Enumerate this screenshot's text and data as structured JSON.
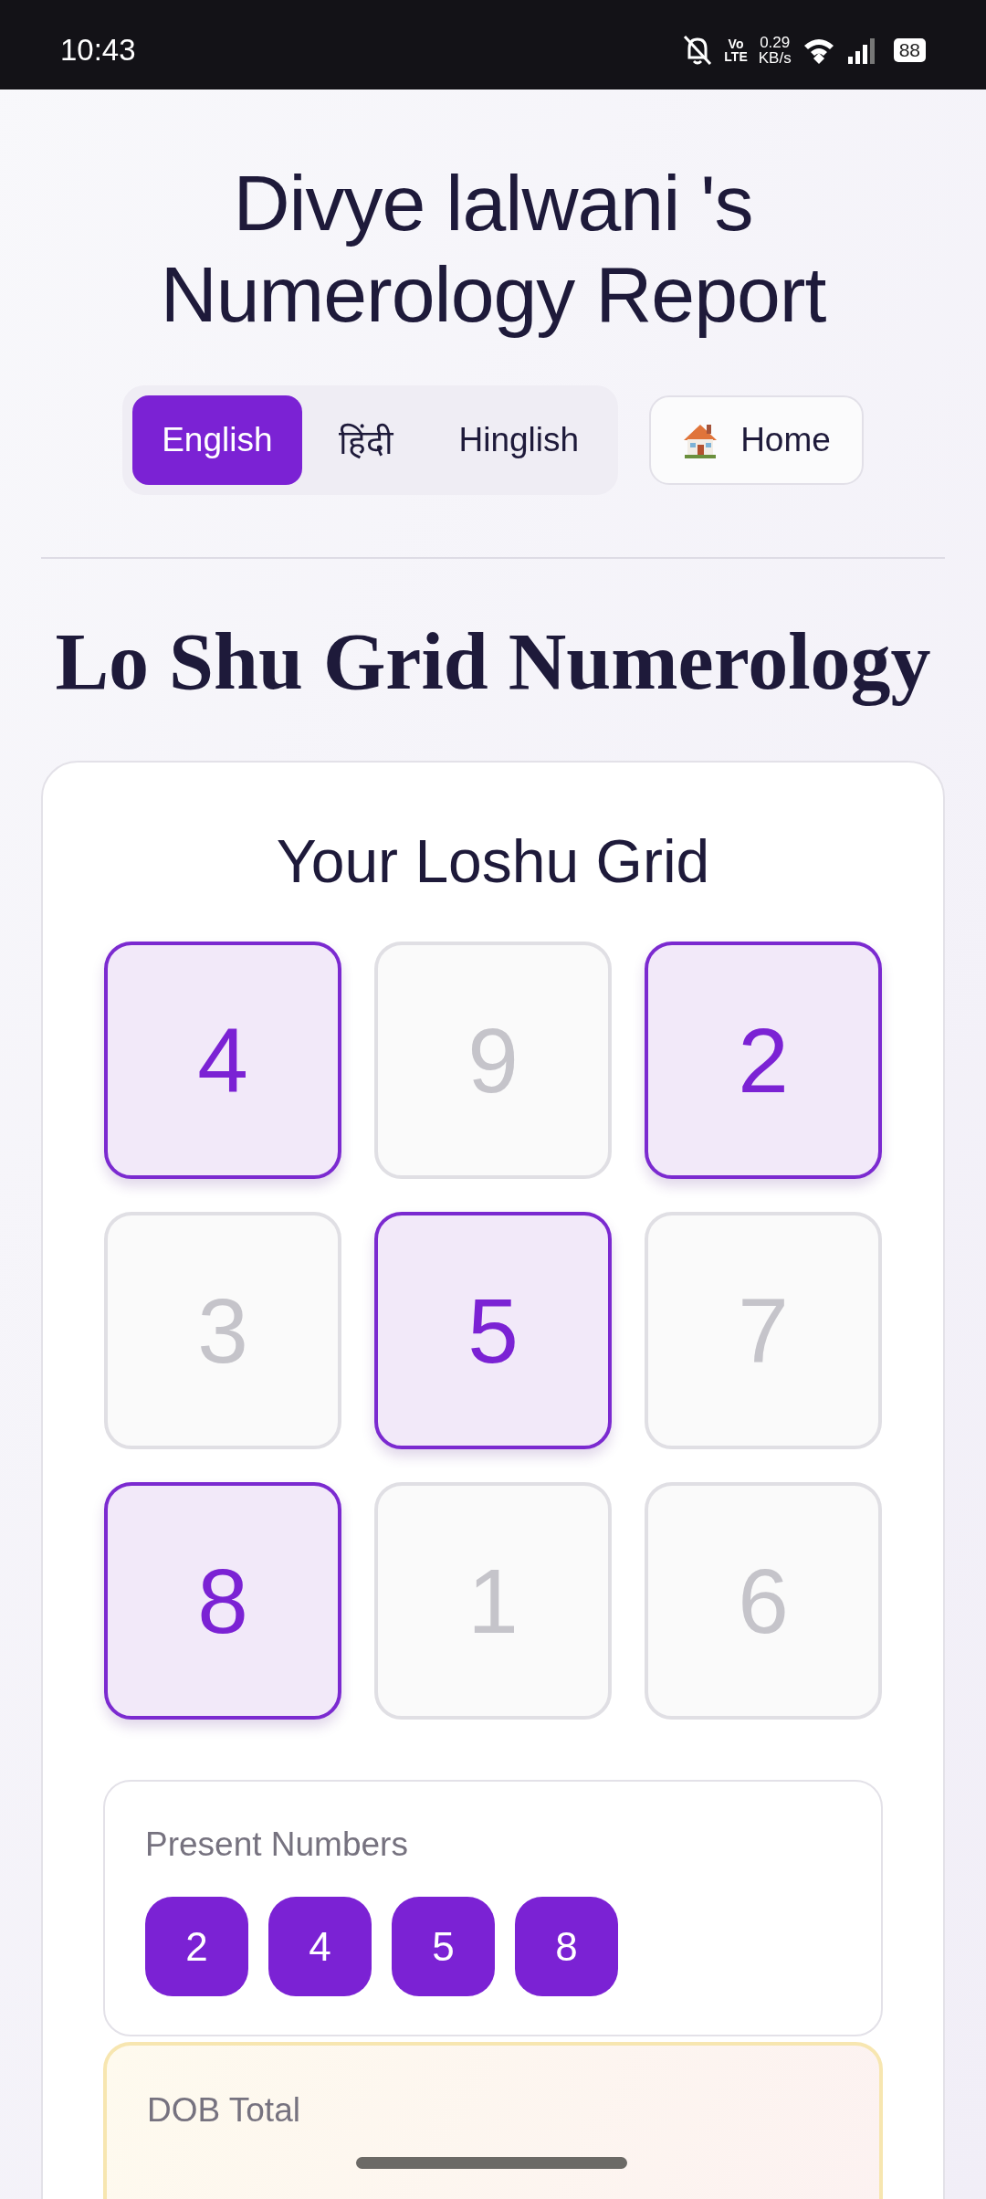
{
  "status_bar": {
    "time": "10:43",
    "volte": [
      "Vo",
      "LTE"
    ],
    "speed": [
      "0.29",
      "KB/s"
    ],
    "battery": "88"
  },
  "header": {
    "title": [
      "Divye lalwani 's",
      "Numerology Report"
    ]
  },
  "language_tabs": [
    {
      "label": "English",
      "selected": true
    },
    {
      "label": "हिंदी",
      "selected": false
    },
    {
      "label": "Hinglish",
      "selected": false
    }
  ],
  "home_button": {
    "label": "Home"
  },
  "section_title": "Lo Shu Grid Numerology",
  "grid_card": {
    "title": "Your Loshu Grid",
    "cells": [
      {
        "value": "4",
        "present": true
      },
      {
        "value": "9",
        "present": false
      },
      {
        "value": "2",
        "present": true
      },
      {
        "value": "3",
        "present": false
      },
      {
        "value": "5",
        "present": true
      },
      {
        "value": "7",
        "present": false
      },
      {
        "value": "8",
        "present": true
      },
      {
        "value": "1",
        "present": false
      },
      {
        "value": "6",
        "present": false
      }
    ],
    "present_numbers": {
      "label": "Present Numbers",
      "numbers": [
        "2",
        "4",
        "5",
        "8"
      ]
    },
    "dob_total": {
      "label": "DOB Total"
    }
  }
}
